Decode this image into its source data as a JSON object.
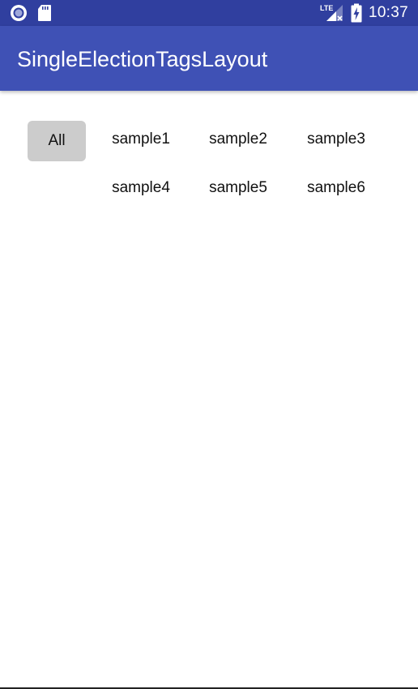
{
  "status_bar": {
    "time": "10:37",
    "left_icons": [
      "circle-app-icon",
      "sd-card-icon"
    ],
    "right_icons": [
      "lte-signal-icon",
      "battery-charging-icon"
    ],
    "network_label": "LTE"
  },
  "app_bar": {
    "title": "SingleElectionTagsLayout",
    "color": "#3f51b5",
    "status_color": "#303f9f"
  },
  "tags": {
    "items": [
      {
        "label": "All",
        "selected": true
      },
      {
        "label": "sample1",
        "selected": false
      },
      {
        "label": "sample2",
        "selected": false
      },
      {
        "label": "sample3",
        "selected": false
      },
      {
        "label": "sample4",
        "selected": false
      },
      {
        "label": "sample5",
        "selected": false
      },
      {
        "label": "sample6",
        "selected": false
      }
    ],
    "selected_color": "#cccccc"
  }
}
